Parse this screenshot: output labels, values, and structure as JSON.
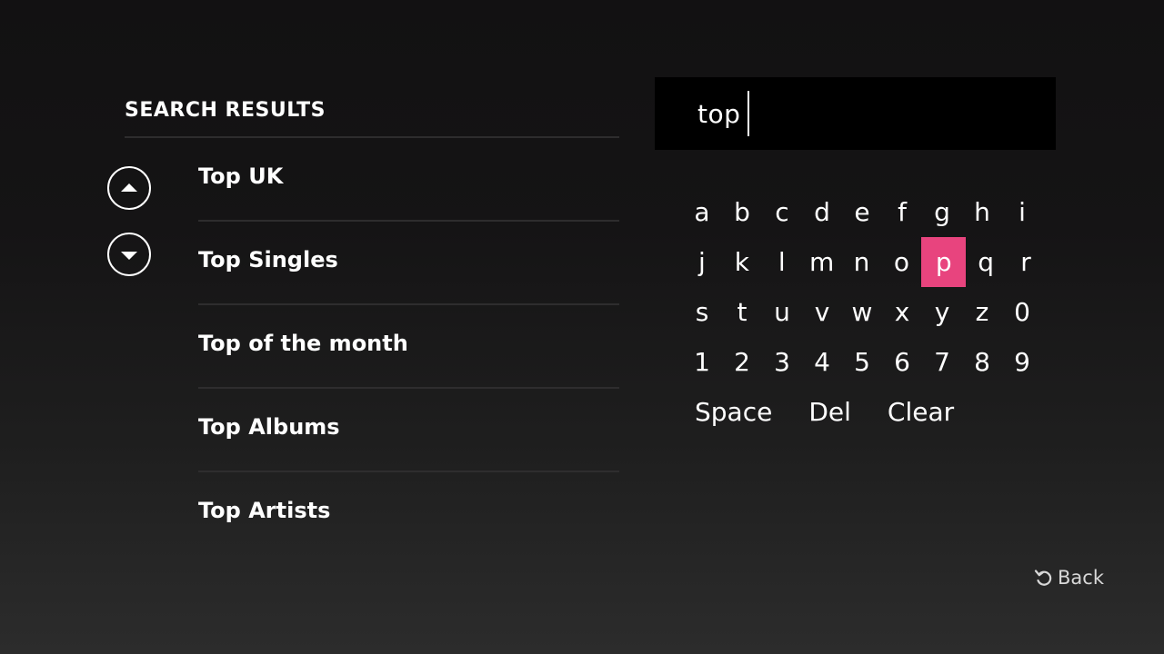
{
  "results": {
    "title": "SEARCH RESULTS",
    "items": [
      {
        "label": "Top UK"
      },
      {
        "label": "Top Singles"
      },
      {
        "label": "Top of the month"
      },
      {
        "label": "Top Albums"
      },
      {
        "label": "Top Artists"
      }
    ],
    "scroll_up_icon": "chevron-up-icon",
    "scroll_down_icon": "chevron-down-icon"
  },
  "search": {
    "query": "top"
  },
  "keyboard": {
    "rows": [
      [
        "a",
        "b",
        "c",
        "d",
        "e",
        "f",
        "g",
        "h",
        "i"
      ],
      [
        "j",
        "k",
        "l",
        "m",
        "n",
        "o",
        "p",
        "q",
        "r"
      ],
      [
        "s",
        "t",
        "u",
        "v",
        "w",
        "x",
        "y",
        "z",
        "0"
      ],
      [
        "1",
        "2",
        "3",
        "4",
        "5",
        "6",
        "7",
        "8",
        "9"
      ]
    ],
    "selected_key": "p",
    "actions": {
      "space": "Space",
      "del": "Del",
      "clear": "Clear"
    },
    "highlight_color": "#e8447e"
  },
  "footer": {
    "back_label": "Back",
    "back_icon": "back-arrow-icon"
  }
}
